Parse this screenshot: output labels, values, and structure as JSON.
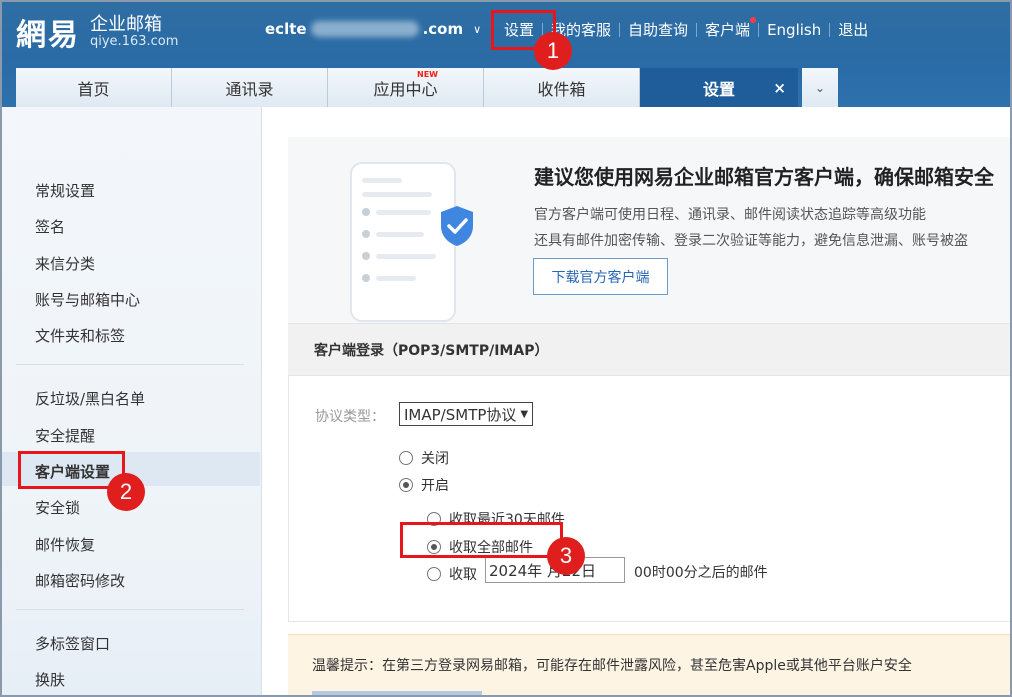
{
  "header": {
    "logo_mark": "網易",
    "logo_title": "企业邮箱",
    "logo_sub": "qiye.163.com",
    "account_prefix": "eclte",
    "account_suffix": ".com",
    "account_chevron": "∨",
    "nav": [
      "设置",
      "我的客服",
      "自助查询",
      "客户端",
      "English",
      "退出"
    ]
  },
  "tabs": {
    "items": [
      {
        "label": "首页"
      },
      {
        "label": "通讯录"
      },
      {
        "label": "应用中心",
        "badge": "NEW"
      },
      {
        "label": "收件箱"
      },
      {
        "label": "设置",
        "close": "×"
      }
    ],
    "more": "⌄"
  },
  "sidebar": {
    "group1": [
      "常规设置",
      "签名",
      "来信分类",
      "账号与邮箱中心",
      "文件夹和标签"
    ],
    "group2": [
      "反垃圾/黑白名单",
      "安全提醒",
      "客户端设置",
      "安全锁",
      "邮件恢复",
      "邮箱密码修改"
    ],
    "group3": [
      "多标签窗口",
      "换肤"
    ]
  },
  "promo": {
    "title": "建议您使用网易企业邮箱官方客户端，确保邮箱安全",
    "line1": "官方客户端可使用日程、通讯录、邮件阅读状态追踪等高级功能",
    "line2": "还具有邮件加密传输、登录二次验证等能力，避免信息泄漏、账号被盗",
    "button": "下载官方客户端"
  },
  "section": {
    "title": "客户端登录（POP3/SMTP/IMAP）",
    "protocol_label": "协议类型：",
    "protocol_value": "IMAP/SMTP协议",
    "opt_off": "关闭",
    "opt_on": "开启",
    "opt_30": "收取最近30天邮件",
    "opt_all": "收取全部邮件",
    "opt_from": "收取",
    "date_value": "2024年 月22日",
    "after_text": "00时00分之后的邮件"
  },
  "tip": {
    "text": "温馨提示：在第三方登录网易邮箱，可能存在邮件泄露风险，甚至危害Apple或其他平台账户安全"
  },
  "annotations": [
    "1",
    "2",
    "3"
  ]
}
